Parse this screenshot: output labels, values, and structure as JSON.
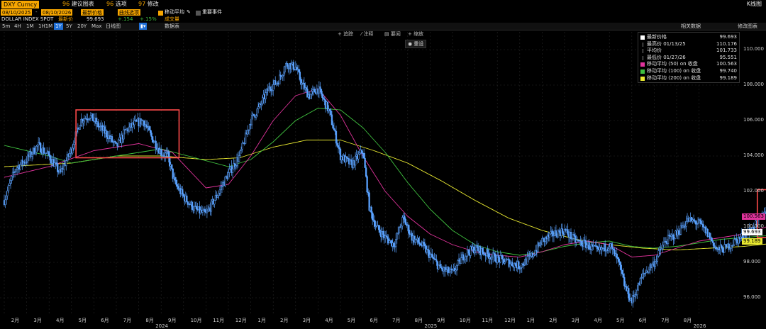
{
  "header": {
    "ticker": "DXY Curncy",
    "date_start": "08/10/2025",
    "date_end": "08/10/2026",
    "menu": [
      {
        "num": "96",
        "label": "建议图表"
      },
      {
        "num": "96",
        "label": "选项"
      },
      {
        "num": "97",
        "label": "修改"
      }
    ],
    "right_title": "K线图",
    "field": "最新价格",
    "style": "曲线选项",
    "ma_label": "移动平均",
    "events_label": "重要事件"
  },
  "info": {
    "name": "DOLLAR INDEX SPOT",
    "last_label": "最新价",
    "last_value": "99.693",
    "change": "+.154",
    "change_pct": "+.15%",
    "volume_label": "成交量"
  },
  "toolbar": {
    "timeframes": [
      "5m",
      "4H",
      "1M",
      "1H1M",
      "1Y",
      "5Y",
      "20Y",
      "Max"
    ],
    "selected": "1Y",
    "interval_label": "日线图",
    "data_label": "数据表",
    "related_label": "相关数据",
    "edit_label": "修改图表"
  },
  "draw_tools": {
    "track": "追踪",
    "annotate": "注释",
    "news": "要闻",
    "zoom": "缩放",
    "reset": "重设"
  },
  "legend": {
    "items": [
      {
        "swatch": "#ffffff",
        "label": "最新价格",
        "value": "99.693"
      },
      {
        "swatch": "",
        "label": "最高价 01/13/25",
        "value": "110.176"
      },
      {
        "swatch": "",
        "label": "平均价",
        "value": "101.733"
      },
      {
        "swatch": "",
        "label": "最低价 01/27/26",
        "value": "95.551"
      },
      {
        "swatch": "#e0339b",
        "label": "移动平均 (50) on 收盘",
        "value": "100.563"
      },
      {
        "swatch": "#3fbf3f",
        "label": "移动平均 (100) on 收盘",
        "value": "99.740"
      },
      {
        "swatch": "#e8e830",
        "label": "移动平均 (200) on 收盘",
        "value": "99.189"
      }
    ]
  },
  "badges": [
    {
      "value": "100.563",
      "color": "#e0339b"
    },
    {
      "value": "99.693",
      "color": "#ffffff"
    },
    {
      "value": "99.189",
      "color": "#e8e830"
    }
  ],
  "chart_data": {
    "type": "line",
    "ylim": [
      95,
      111
    ],
    "yticks": [
      "110.000",
      "108.000",
      "106.000",
      "104.000",
      "102.000",
      "100.000",
      "98.000",
      "96.000"
    ],
    "ytick_values": [
      110,
      108,
      106,
      104,
      102,
      100,
      98,
      96
    ],
    "months": [
      "2月",
      "3月",
      "4月",
      "5月",
      "6月",
      "7月",
      "8月",
      "9月",
      "10月",
      "11月",
      "12月",
      "1月",
      "2月",
      "3月",
      "4月",
      "5月",
      "6月",
      "7月",
      "8月",
      "9月",
      "10月",
      "11月",
      "12月",
      "1月",
      "2月",
      "3月",
      "4月",
      "5月",
      "6月",
      "7月",
      "8月"
    ],
    "years": [
      "2024",
      "2025",
      "2026"
    ],
    "colors": {
      "price": "#5aa2ff",
      "ma50": "#e0339b",
      "ma100": "#3fbf3f",
      "ma200": "#e8e830",
      "box": "#ff4a4a"
    },
    "price_anchors": [
      [
        0,
        101.5
      ],
      [
        0.5,
        103.3
      ],
      [
        1,
        103.8
      ],
      [
        1.5,
        104.6
      ],
      [
        2,
        104.0
      ],
      [
        2.5,
        103.0
      ],
      [
        3,
        104.4
      ],
      [
        3.4,
        106.0
      ],
      [
        3.8,
        106.3
      ],
      [
        4.2,
        105.7
      ],
      [
        4.6,
        105.2
      ],
      [
        5,
        104.5
      ],
      [
        5.4,
        105.4
      ],
      [
        5.8,
        105.8
      ],
      [
        6.2,
        106.0
      ],
      [
        6.6,
        105.0
      ],
      [
        7,
        104.2
      ],
      [
        7.3,
        104.0
      ],
      [
        7.6,
        102.5
      ],
      [
        8,
        101.7
      ],
      [
        8.5,
        101.0
      ],
      [
        9,
        100.7
      ],
      [
        9.5,
        101.8
      ],
      [
        10,
        103.0
      ],
      [
        10.5,
        104.0
      ],
      [
        11,
        106.0
      ],
      [
        11.4,
        106.8
      ],
      [
        11.8,
        107.8
      ],
      [
        12.2,
        108.2
      ],
      [
        12.6,
        109.2
      ],
      [
        13,
        109.0
      ],
      [
        13.3,
        108.0
      ],
      [
        13.6,
        107.4
      ],
      [
        14,
        107.8
      ],
      [
        14.5,
        106.5
      ],
      [
        15,
        104.0
      ],
      [
        15.5,
        103.5
      ],
      [
        16,
        104.3
      ],
      [
        16.3,
        101.0
      ],
      [
        16.6,
        100.0
      ],
      [
        17,
        99.4
      ],
      [
        17.4,
        99.0
      ],
      [
        17.8,
        100.5
      ],
      [
        18.2,
        99.4
      ],
      [
        18.6,
        99.0
      ],
      [
        19,
        98.4
      ],
      [
        19.5,
        97.6
      ],
      [
        20,
        97.4
      ],
      [
        20.5,
        98.4
      ],
      [
        21,
        98.8
      ],
      [
        21.5,
        98.5
      ],
      [
        22,
        98.2
      ],
      [
        22.5,
        98.0
      ],
      [
        23,
        97.8
      ],
      [
        23.5,
        98.3
      ],
      [
        24,
        99.2
      ],
      [
        24.5,
        99.6
      ],
      [
        25,
        99.8
      ],
      [
        25.5,
        99.2
      ],
      [
        26,
        99.0
      ],
      [
        26.5,
        98.6
      ],
      [
        27,
        99.0
      ],
      [
        27.4,
        98.0
      ],
      [
        27.7,
        96.6
      ],
      [
        28,
        95.8
      ],
      [
        28.5,
        97.3
      ],
      [
        29,
        98.0
      ],
      [
        29.5,
        99.2
      ],
      [
        30,
        99.6
      ],
      [
        30.5,
        100.4
      ],
      [
        31,
        100.2
      ],
      [
        31.4,
        99.6
      ],
      [
        31.8,
        98.7
      ],
      [
        32.2,
        98.8
      ],
      [
        32.6,
        99.2
      ],
      [
        33,
        99.5
      ],
      [
        33.4,
        99.9
      ],
      [
        33.8,
        100.6
      ],
      [
        34.2,
        101.4
      ],
      [
        34.6,
        101.6
      ],
      [
        35,
        101.2
      ],
      [
        35.4,
        101.4
      ],
      [
        35.7,
        101.6
      ],
      [
        35.9,
        100.4
      ],
      [
        36.1,
        99.7
      ]
    ],
    "ma50": [
      [
        0,
        102.8
      ],
      [
        2,
        103.4
      ],
      [
        4,
        104.3
      ],
      [
        6,
        104.7
      ],
      [
        7.5,
        104.2
      ],
      [
        9,
        102.2
      ],
      [
        10,
        102.4
      ],
      [
        11,
        104.0
      ],
      [
        12,
        106.0
      ],
      [
        13,
        107.4
      ],
      [
        14,
        107.8
      ],
      [
        15,
        106.3
      ],
      [
        16,
        104.0
      ],
      [
        17,
        102.0
      ],
      [
        18,
        100.6
      ],
      [
        19,
        99.6
      ],
      [
        20,
        99.0
      ],
      [
        21,
        98.6
      ],
      [
        22,
        98.4
      ],
      [
        23,
        98.3
      ],
      [
        24,
        98.6
      ],
      [
        25,
        99.0
      ],
      [
        26,
        99.2
      ],
      [
        27,
        99.0
      ],
      [
        28,
        98.3
      ],
      [
        29,
        98.4
      ],
      [
        30,
        98.8
      ],
      [
        31,
        99.2
      ],
      [
        32,
        99.4
      ],
      [
        33,
        99.6
      ],
      [
        34,
        100.0
      ],
      [
        35,
        100.6
      ],
      [
        36.1,
        100.56
      ]
    ],
    "ma100": [
      [
        0,
        104.6
      ],
      [
        2,
        104.0
      ],
      [
        3,
        103.6
      ],
      [
        5,
        104.0
      ],
      [
        7,
        104.4
      ],
      [
        8.5,
        103.9
      ],
      [
        10,
        103.4
      ],
      [
        11,
        103.8
      ],
      [
        12,
        104.8
      ],
      [
        13,
        106.0
      ],
      [
        14,
        106.7
      ],
      [
        15,
        106.6
      ],
      [
        16,
        105.6
      ],
      [
        17,
        104.2
      ],
      [
        18,
        102.5
      ],
      [
        19,
        101.0
      ],
      [
        20,
        99.8
      ],
      [
        21,
        99.0
      ],
      [
        22,
        98.6
      ],
      [
        23,
        98.4
      ],
      [
        24,
        98.6
      ],
      [
        25,
        98.9
      ],
      [
        26,
        99.1
      ],
      [
        27,
        99.2
      ],
      [
        28,
        98.9
      ],
      [
        29,
        98.8
      ],
      [
        30,
        98.9
      ],
      [
        31,
        99.1
      ],
      [
        32,
        99.3
      ],
      [
        33,
        99.4
      ],
      [
        34,
        99.5
      ],
      [
        35,
        99.6
      ],
      [
        36.1,
        99.74
      ]
    ],
    "ma200": [
      [
        0,
        103.4
      ],
      [
        3,
        103.6
      ],
      [
        5,
        104.0
      ],
      [
        7,
        104.0
      ],
      [
        9,
        103.8
      ],
      [
        10.5,
        103.9
      ],
      [
        12,
        104.5
      ],
      [
        13.5,
        104.9
      ],
      [
        15,
        104.9
      ],
      [
        16.5,
        104.3
      ],
      [
        18,
        103.6
      ],
      [
        19.5,
        102.6
      ],
      [
        21,
        101.5
      ],
      [
        22.5,
        100.5
      ],
      [
        24,
        99.8
      ],
      [
        25.5,
        99.3
      ],
      [
        27,
        99.0
      ],
      [
        28.5,
        98.8
      ],
      [
        30,
        98.7
      ],
      [
        31.5,
        98.8
      ],
      [
        33,
        98.9
      ],
      [
        34.5,
        99.1
      ],
      [
        36.1,
        99.19
      ]
    ],
    "boxes": [
      {
        "from": 3.2,
        "to": 7.8,
        "low": 103.9,
        "high": 106.6
      },
      {
        "from": 33.6,
        "to": 36.4,
        "low": 99.4,
        "high": 102.1
      }
    ]
  }
}
